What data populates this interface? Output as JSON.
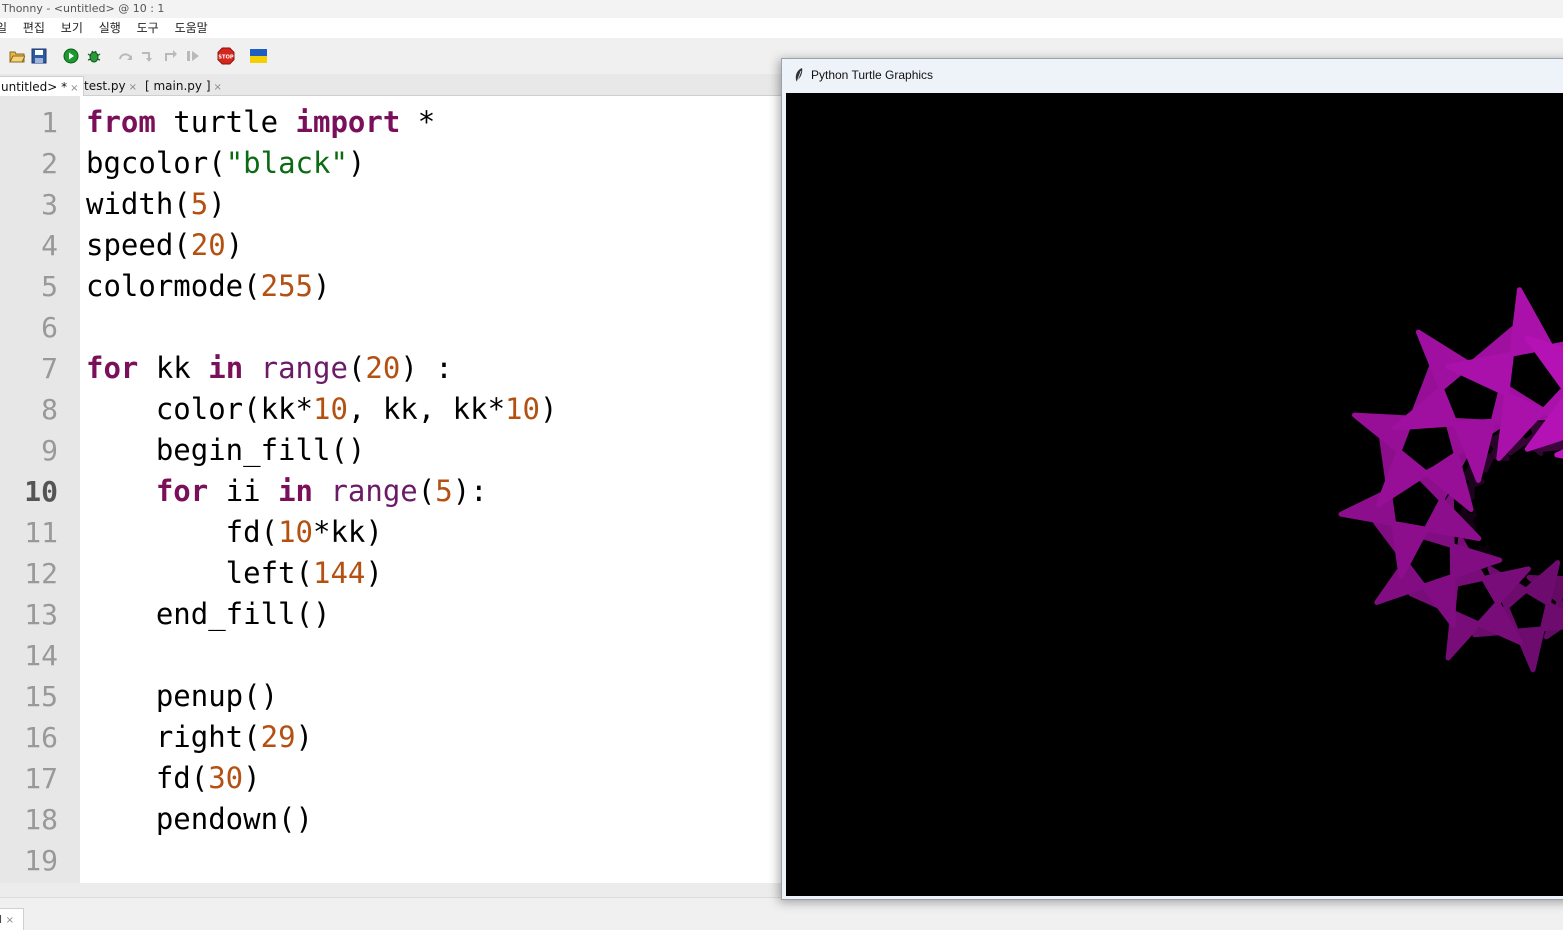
{
  "window": {
    "title": "Thonny  -  <untitled>  @  10 : 1"
  },
  "menu": [
    "일",
    "편집",
    "보기",
    "실행",
    "도구",
    "도움말"
  ],
  "toolbar": {
    "icons": [
      "open-icon",
      "save-icon",
      "run-icon",
      "debug-icon",
      "step-over-icon",
      "step-into-icon",
      "step-out-icon",
      "resume-icon",
      "stop-icon",
      "ukraine-flag-icon"
    ],
    "stop_label": "STOP"
  },
  "tabs": [
    {
      "label": "untitled> *",
      "active": true
    },
    {
      "label": "test.py",
      "active": false
    },
    {
      "label": "[ main.py ]",
      "active": false
    }
  ],
  "tab_close_glyph": "×",
  "editor": {
    "current_line": 10,
    "line_numbers": [
      "1",
      "2",
      "3",
      "4",
      "5",
      "6",
      "7",
      "8",
      "9",
      "10",
      "11",
      "12",
      "13",
      "14",
      "15",
      "16",
      "17",
      "18",
      "19"
    ],
    "lines": [
      [
        {
          "t": "from",
          "c": "kw"
        },
        {
          "t": " turtle ",
          "c": ""
        },
        {
          "t": "import",
          "c": "kw"
        },
        {
          "t": " *",
          "c": ""
        }
      ],
      [
        {
          "t": "bgcolor(",
          "c": ""
        },
        {
          "t": "\"black\"",
          "c": "st"
        },
        {
          "t": ")",
          "c": ""
        }
      ],
      [
        {
          "t": "width(",
          "c": ""
        },
        {
          "t": "5",
          "c": "nu"
        },
        {
          "t": ")",
          "c": ""
        }
      ],
      [
        {
          "t": "speed(",
          "c": ""
        },
        {
          "t": "20",
          "c": "nu"
        },
        {
          "t": ")",
          "c": ""
        }
      ],
      [
        {
          "t": "colormode(",
          "c": ""
        },
        {
          "t": "255",
          "c": "nu"
        },
        {
          "t": ")",
          "c": ""
        }
      ],
      [],
      [
        {
          "t": "for",
          "c": "kw"
        },
        {
          "t": " kk ",
          "c": ""
        },
        {
          "t": "in",
          "c": "kw"
        },
        {
          "t": " ",
          "c": ""
        },
        {
          "t": "range",
          "c": "bi"
        },
        {
          "t": "(",
          "c": ""
        },
        {
          "t": "20",
          "c": "nu"
        },
        {
          "t": ") :",
          "c": ""
        }
      ],
      [
        {
          "t": "    color(kk*",
          "c": ""
        },
        {
          "t": "10",
          "c": "nu"
        },
        {
          "t": ", kk, kk*",
          "c": ""
        },
        {
          "t": "10",
          "c": "nu"
        },
        {
          "t": ")",
          "c": ""
        }
      ],
      [
        {
          "t": "    begin_fill()",
          "c": ""
        }
      ],
      [
        {
          "t": "    ",
          "c": ""
        },
        {
          "t": "for",
          "c": "kw"
        },
        {
          "t": " ii ",
          "c": ""
        },
        {
          "t": "in",
          "c": "kw"
        },
        {
          "t": " ",
          "c": ""
        },
        {
          "t": "range",
          "c": "bi"
        },
        {
          "t": "(",
          "c": ""
        },
        {
          "t": "5",
          "c": "nu"
        },
        {
          "t": "):",
          "c": ""
        }
      ],
      [
        {
          "t": "        fd(",
          "c": ""
        },
        {
          "t": "10",
          "c": "nu"
        },
        {
          "t": "*kk)",
          "c": ""
        }
      ],
      [
        {
          "t": "        left(",
          "c": ""
        },
        {
          "t": "144",
          "c": "nu"
        },
        {
          "t": ")",
          "c": ""
        }
      ],
      [
        {
          "t": "    end_fill()",
          "c": ""
        }
      ],
      [],
      [
        {
          "t": "    penup()",
          "c": ""
        }
      ],
      [
        {
          "t": "    right(",
          "c": ""
        },
        {
          "t": "29",
          "c": "nu"
        },
        {
          "t": ")",
          "c": ""
        }
      ],
      [
        {
          "t": "    fd(",
          "c": ""
        },
        {
          "t": "30",
          "c": "nu"
        },
        {
          "t": ")",
          "c": ""
        }
      ],
      [
        {
          "t": "    pendown()",
          "c": ""
        }
      ],
      []
    ]
  },
  "bottom_tab": {
    "label": "l",
    "close": "×"
  },
  "turtle_window": {
    "title": "Python Turtle Graphics",
    "background": "#000000",
    "pen_width": 5,
    "stars_drawn": 20,
    "star_angle_deg": 144,
    "turn_deg": 29,
    "step": 30,
    "size_multiplier": 10,
    "color_rule": "rgb(kk*10, kk, kk*10)"
  }
}
